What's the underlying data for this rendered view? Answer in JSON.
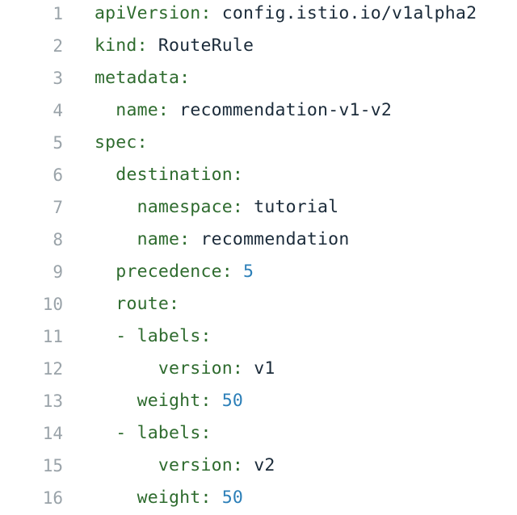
{
  "editor": {
    "lines": [
      {
        "number": "1",
        "indent": "",
        "dash": "",
        "key": "apiVersion",
        "value": "config.istio.io/v1alpha2",
        "value_type": "str"
      },
      {
        "number": "2",
        "indent": "",
        "dash": "",
        "key": "kind",
        "value": "RouteRule",
        "value_type": "str"
      },
      {
        "number": "3",
        "indent": "",
        "dash": "",
        "key": "metadata",
        "value": "",
        "value_type": "str"
      },
      {
        "number": "4",
        "indent": "  ",
        "dash": "",
        "key": "name",
        "value": "recommendation-v1-v2",
        "value_type": "str"
      },
      {
        "number": "5",
        "indent": "",
        "dash": "",
        "key": "spec",
        "value": "",
        "value_type": "str"
      },
      {
        "number": "6",
        "indent": "  ",
        "dash": "",
        "key": "destination",
        "value": "",
        "value_type": "str"
      },
      {
        "number": "7",
        "indent": "    ",
        "dash": "",
        "key": "namespace",
        "value": "tutorial",
        "value_type": "str"
      },
      {
        "number": "8",
        "indent": "    ",
        "dash": "",
        "key": "name",
        "value": "recommendation",
        "value_type": "str"
      },
      {
        "number": "9",
        "indent": "  ",
        "dash": "",
        "key": "precedence",
        "value": "5",
        "value_type": "num"
      },
      {
        "number": "10",
        "indent": "  ",
        "dash": "",
        "key": "route",
        "value": "",
        "value_type": "str"
      },
      {
        "number": "11",
        "indent": "  ",
        "dash": "- ",
        "key": "labels",
        "value": "",
        "value_type": "str"
      },
      {
        "number": "12",
        "indent": "      ",
        "dash": "",
        "key": "version",
        "value": "v1",
        "value_type": "str"
      },
      {
        "number": "13",
        "indent": "    ",
        "dash": "",
        "key": "weight",
        "value": "50",
        "value_type": "num"
      },
      {
        "number": "14",
        "indent": "  ",
        "dash": "- ",
        "key": "labels",
        "value": "",
        "value_type": "str"
      },
      {
        "number": "15",
        "indent": "      ",
        "dash": "",
        "key": "version",
        "value": "v2",
        "value_type": "str"
      },
      {
        "number": "16",
        "indent": "    ",
        "dash": "",
        "key": "weight",
        "value": "50",
        "value_type": "num"
      }
    ],
    "colors": {
      "key": "#2e6b2e",
      "string": "#1b2b3a",
      "number": "#2c7fb8",
      "line_number": "#9aa3a9",
      "background": "#ffffff"
    }
  }
}
